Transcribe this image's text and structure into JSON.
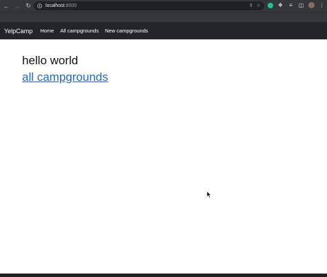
{
  "browser": {
    "url_host": "localhost",
    "url_port": ":8000",
    "back_icon": "arrow-left-icon",
    "forward_icon": "arrow-right-icon",
    "reload_icon": "reload-icon"
  },
  "navbar": {
    "brand": "YelpCamp",
    "links": [
      "Home",
      "All campgrounds",
      "New campgrounds"
    ]
  },
  "main": {
    "heading": "hello world",
    "link_text": "all campgrounds"
  },
  "colors": {
    "navbar_bg": "#212529",
    "link": "#1e68d2",
    "chrome": "#35363a"
  }
}
